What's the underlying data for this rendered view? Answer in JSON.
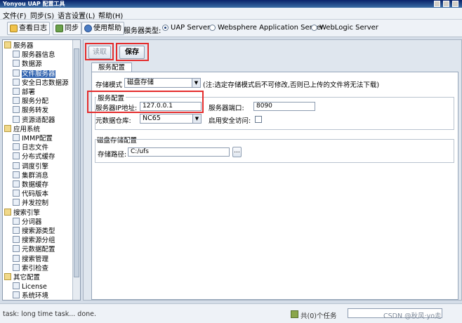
{
  "window": {
    "title": "Yonyou UAP 配置工具"
  },
  "menu": {
    "items": [
      "文件(F)",
      "同步(S)",
      "语言设置(L)",
      "帮助(H)"
    ]
  },
  "toolbar": {
    "view_log": "查看日志",
    "sync": "同步",
    "help": "使用帮助",
    "server_type_label": "服务器类型:",
    "radios": [
      {
        "label": "UAP Server",
        "checked": true
      },
      {
        "label": "Websphere Application Server",
        "checked": false
      },
      {
        "label": "WebLogic Server",
        "checked": false
      }
    ]
  },
  "tree": {
    "items": [
      {
        "label": "服务器",
        "icon": "folder-icon",
        "level": 0,
        "selected": false
      },
      {
        "label": "服务器信息",
        "icon": "server-icon",
        "level": 1,
        "selected": false
      },
      {
        "label": "数据源",
        "icon": "database-icon",
        "level": 1,
        "selected": false
      },
      {
        "label": "文件服务器",
        "icon": "file-server-icon",
        "level": 1,
        "selected": true
      },
      {
        "label": "安全日志数据源",
        "icon": "security-log-icon",
        "level": 1,
        "selected": false
      },
      {
        "label": "部署",
        "icon": "deploy-icon",
        "level": 1,
        "selected": false
      },
      {
        "label": "服务分配",
        "icon": "service-assign-icon",
        "level": 1,
        "selected": false
      },
      {
        "label": "服务转发",
        "icon": "service-forward-icon",
        "level": 1,
        "selected": false
      },
      {
        "label": "资源适配器",
        "icon": "resource-adapter-icon",
        "level": 1,
        "selected": false
      },
      {
        "label": "应用系统",
        "icon": "folder-icon",
        "level": 0,
        "selected": false
      },
      {
        "label": "IMMP配置",
        "icon": "immp-icon",
        "level": 1,
        "selected": false
      },
      {
        "label": "日志文件",
        "icon": "log-file-icon",
        "level": 1,
        "selected": false
      },
      {
        "label": "分布式缓存",
        "icon": "page-icon",
        "level": 1,
        "selected": false
      },
      {
        "label": "调度引擎",
        "icon": "schedule-icon",
        "level": 1,
        "selected": false
      },
      {
        "label": "集群消息",
        "icon": "mail-icon",
        "level": 1,
        "selected": false
      },
      {
        "label": "数据缓存",
        "icon": "data-cache-icon",
        "level": 1,
        "selected": false
      },
      {
        "label": "代码版本",
        "icon": "page-icon",
        "level": 1,
        "selected": false
      },
      {
        "label": "并发控制",
        "icon": "grid-icon",
        "level": 1,
        "selected": false
      },
      {
        "label": "搜索引擎",
        "icon": "folder-icon",
        "level": 0,
        "selected": false
      },
      {
        "label": "分词器",
        "icon": "page-icon",
        "level": 1,
        "selected": false
      },
      {
        "label": "搜索源类型",
        "icon": "page-icon",
        "level": 1,
        "selected": false
      },
      {
        "label": "搜索源分组",
        "icon": "page-icon",
        "level": 1,
        "selected": false
      },
      {
        "label": "元数据配置",
        "icon": "page-icon",
        "level": 1,
        "selected": false
      },
      {
        "label": "搜索管理",
        "icon": "page-icon",
        "level": 1,
        "selected": false
      },
      {
        "label": "索引检查",
        "icon": "page-icon",
        "level": 1,
        "selected": false
      },
      {
        "label": "其它配置",
        "icon": "folder-icon",
        "level": 0,
        "selected": false
      },
      {
        "label": "License",
        "icon": "license-icon",
        "level": 1,
        "selected": false
      },
      {
        "label": "系统环境",
        "icon": "system-env-icon",
        "level": 1,
        "selected": false
      }
    ]
  },
  "actions": {
    "read": "读取",
    "save": "保存"
  },
  "tab": {
    "label": "服务配置"
  },
  "form": {
    "storage_mode_label": "存储模式",
    "storage_mode_value": "磁盘存储",
    "storage_mode_note": "(注:选定存储模式后不可修改,否则已上传的文件将无法下载)",
    "server_group_title": "服务配置",
    "ip_label": "服务器IP地址:",
    "ip_value": "127.0.0.1",
    "port_label": "服务器端口:",
    "port_value": "8090",
    "meta_repo_label": "元数据仓库:",
    "meta_repo_value": "NC65",
    "secure_access_label": "启用安全访问:",
    "secure_access_checked": false,
    "disk_group_title": "磁盘存储配置",
    "storage_path_label": "存储路径:",
    "storage_path_value": "C:/ufs",
    "browse_label": "..."
  },
  "status": {
    "message": "task: long time task... done.",
    "tasks": "共(0)个任务",
    "watermark": "CSDN @秋风·yo走"
  }
}
